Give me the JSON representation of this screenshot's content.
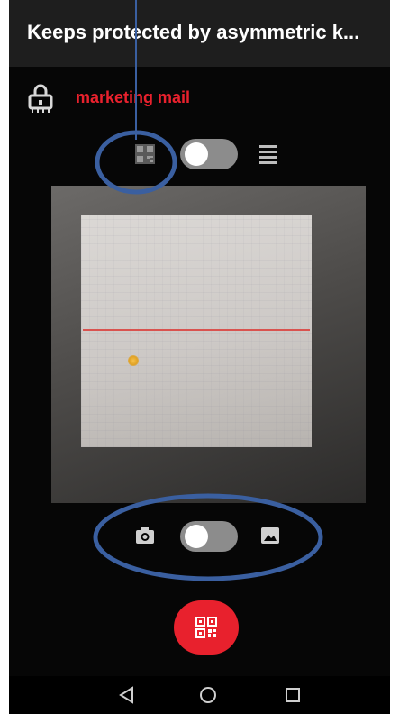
{
  "header": {
    "title": "Keeps protected by asymmetric k..."
  },
  "account": {
    "name": "marketing mail",
    "icon": "lock-icon"
  },
  "mode_switch": {
    "left_icon": "qr-code-icon",
    "right_icon": "text-lines-icon",
    "state": "off"
  },
  "source_switch": {
    "left_icon": "camera-icon",
    "right_icon": "image-icon",
    "state": "off"
  },
  "fab": {
    "icon": "qr-code-icon"
  },
  "nav": {
    "back_icon": "back-icon",
    "home_icon": "home-icon",
    "recents_icon": "recents-icon"
  },
  "colors": {
    "accent": "#e8212d",
    "annotation": "#3a5fa0",
    "title_bar": "#1e1e1e",
    "background": "#060606"
  }
}
